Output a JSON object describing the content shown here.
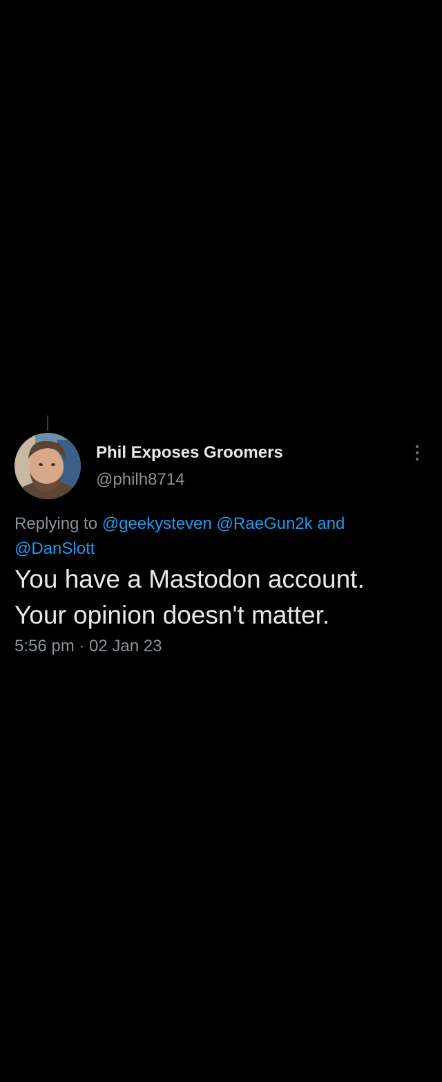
{
  "tweet": {
    "author": {
      "display_name": "Phil Exposes Groomers",
      "handle": "@philh8714"
    },
    "replying_to": {
      "prefix": "Replying to",
      "mentions": [
        "@geekysteven",
        "@RaeGun2k",
        "@DanSlott"
      ],
      "conjunction": "and"
    },
    "text_lines": [
      "You have a Mastodon account.",
      "Your opinion doesn't matter."
    ],
    "timestamp": "5:56 pm · 02 Jan 23",
    "icons": {
      "more": "more-vertical-icon",
      "avatar": "profile-photo"
    },
    "colors": {
      "background": "#000000",
      "primary_text": "#e7e9ea",
      "secondary_text": "#8b9197",
      "link": "#1d9bf0"
    }
  }
}
